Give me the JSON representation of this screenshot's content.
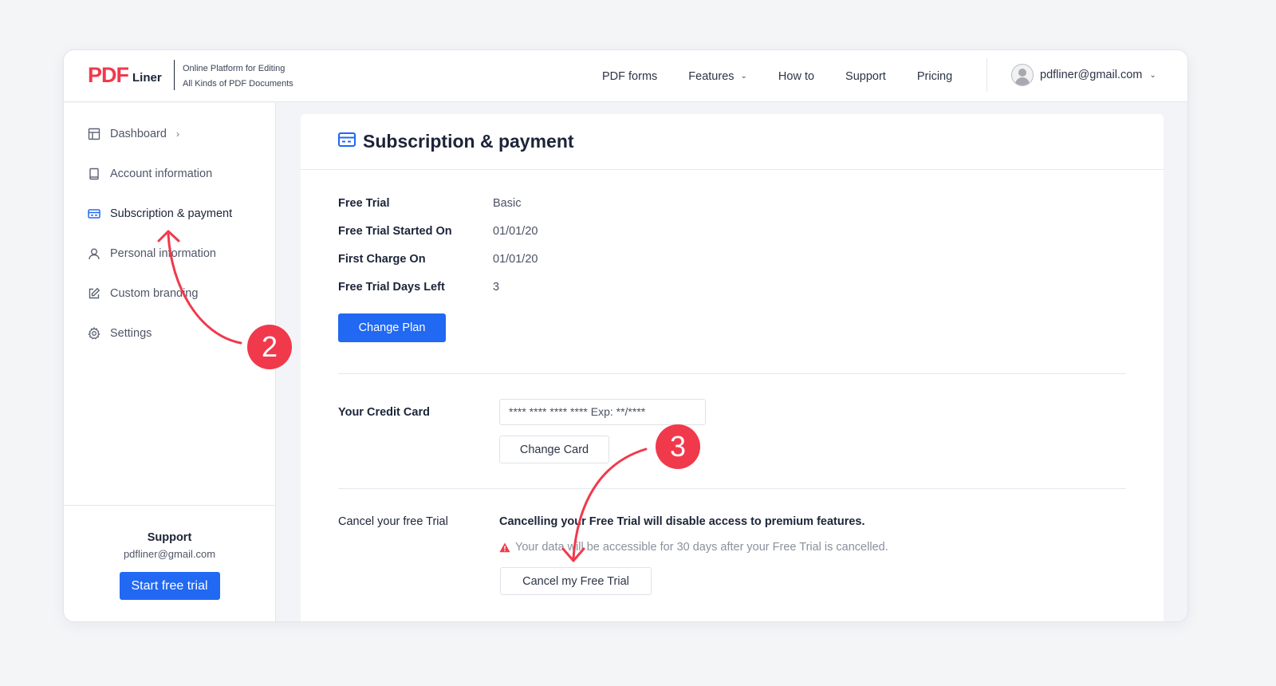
{
  "header": {
    "logo_text": "PDF",
    "logo_suffix": "Liner",
    "tagline_line1": "Online Platform for Editing",
    "tagline_line2": "All Kinds of PDF Documents",
    "nav": [
      {
        "label": "PDF forms"
      },
      {
        "label": "Features",
        "dropdown": true
      },
      {
        "label": "How to"
      },
      {
        "label": "Support"
      },
      {
        "label": "Pricing"
      }
    ],
    "user_email": "pdfliner@gmail.com"
  },
  "sidebar": {
    "items": [
      {
        "label": "Dashboard",
        "icon": "layout-icon"
      },
      {
        "label": "Account information",
        "icon": "book-icon"
      },
      {
        "label": "Subscription & payment",
        "icon": "credit-card-icon",
        "active": true
      },
      {
        "label": "Personal information",
        "icon": "user-icon"
      },
      {
        "label": "Custom branding",
        "icon": "edit-icon"
      },
      {
        "label": "Settings",
        "icon": "gear-icon"
      }
    ],
    "support_title": "Support",
    "support_email": "pdfliner@gmail.com",
    "start_trial_label": "Start free trial"
  },
  "main": {
    "title": "Subscription & payment",
    "details": [
      {
        "label": "Free Trial",
        "value": "Basic"
      },
      {
        "label": "Free Trial Started On",
        "value": "01/01/20"
      },
      {
        "label": "First Charge On",
        "value": "01/01/20"
      },
      {
        "label": "Free Trial Days Left",
        "value": "3"
      }
    ],
    "change_plan_label": "Change Plan",
    "credit_card_label": "Your Credit Card",
    "credit_card_value": "**** **** **** **** Exp: **/****",
    "change_card_label": "Change Card",
    "cancel_label": "Cancel your free Trial",
    "cancel_message": "Cancelling your Free Trial will disable access to premium features.",
    "cancel_warning": "Your data will be accessible for 30 days after your Free Trial is cancelled.",
    "cancel_button_label": "Cancel my Free Trial"
  },
  "annotations": {
    "step_2": "2",
    "step_3": "3",
    "color": "#f1394c"
  },
  "colors": {
    "brand": "#f1394c",
    "primary": "#2168f2",
    "text": "#1c2439"
  }
}
